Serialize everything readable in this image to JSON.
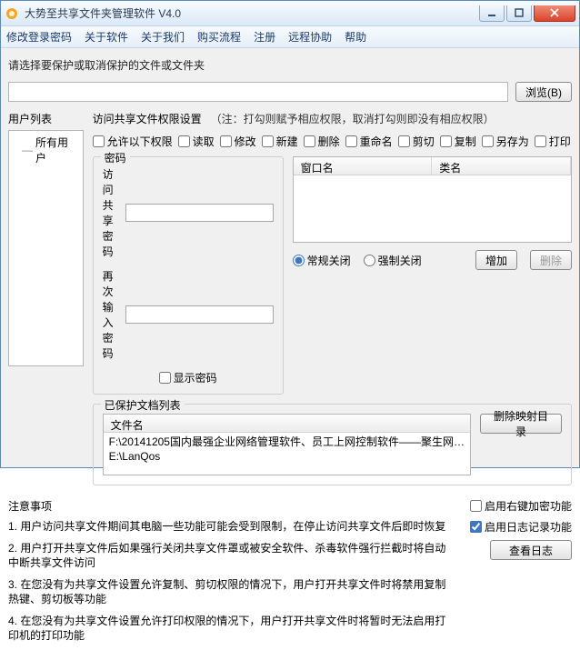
{
  "window": {
    "title": "大势至共享文件夹管理软件 V4.0"
  },
  "menu": {
    "changePw": "修改登录密码",
    "about": "关于软件",
    "aboutUs": "关于我们",
    "purchase": "购买流程",
    "register": "注册",
    "remote": "远程协助",
    "help": "帮助"
  },
  "path": {
    "label": "请选择要保护或取消保护的文件或文件夹",
    "browse": "浏览(B)"
  },
  "users": {
    "label": "用户列表",
    "all": "所有用户"
  },
  "perm": {
    "title": "访问共享文件权限设置",
    "note": "（注：打勾则赋予相应权限，取消打勾则即没有相应权限）",
    "allowBelow": "允许以下权限",
    "read": "读取",
    "modify": "修改",
    "create": "新建",
    "delete": "删除",
    "rename": "重命名",
    "cut": "剪切",
    "copy": "复制",
    "saveAs": "另存为",
    "print": "打印"
  },
  "pw": {
    "legend": "密码",
    "access": "访问共享密码",
    "again": "再次输入密码",
    "show": "显示密码"
  },
  "wintbl": {
    "col1": "窗口名",
    "col2": "类名"
  },
  "closeopt": {
    "normal": "常规关闭",
    "force": "强制关闭",
    "add": "增加",
    "del": "删除"
  },
  "prot": {
    "legend": "已保护文档列表",
    "col": "文件名",
    "delMap": "删除映射目录",
    "rows": [
      "F:\\20141205国内最强企业网络管理软件、员工上网控制软件——聚生网…",
      "E:\\LanQos"
    ]
  },
  "notes": {
    "title": "注意事项",
    "n1": "1. 用户访问共享文件期间其电脑一些功能可能会受到限制，在停止访问共享文件后即时恢复",
    "n2": "2. 用户打开共享文件后如果强行关闭共享文件罩或被安全软件、杀毒软件强行拦截时将自动中断共享文件访问",
    "n3": "3. 在您没有为共享文件设置允许复制、剪切权限的情况下，用户打开共享文件时将禁用复制热键、剪切板等功能",
    "n4": "4. 在您没有为共享文件设置允许打印权限的情况下，用户打开共享文件时将暂时无法启用打印机的打印功能"
  },
  "opts": {
    "rclick": "启用右键加密功能",
    "log": "启用日志记录功能",
    "viewLog": "查看日志"
  }
}
